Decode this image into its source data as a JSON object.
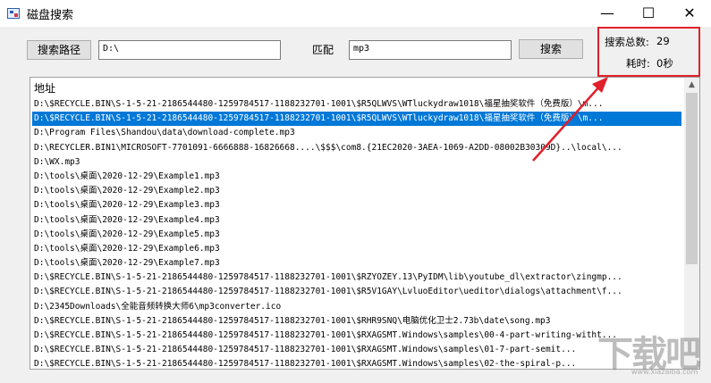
{
  "window": {
    "title": "磁盘搜索",
    "minimize": "—",
    "maximize": "☐",
    "close": "✕"
  },
  "search": {
    "path_button": "搜索路径",
    "path_value": "D:\\",
    "match_label": "匹配",
    "match_value": "mp3",
    "search_button": "搜索"
  },
  "stats": {
    "total_label": "搜索总数:",
    "total_value": "29",
    "time_label": "耗时:",
    "time_value": "0秒"
  },
  "list": {
    "header": "地址",
    "selected_index": 1,
    "rows": [
      "D:\\$RECYCLE.BIN\\S-1-5-21-2186544480-1259784517-1188232701-1001\\$R5QLWVS\\WTluckydraw1018\\福星抽奖软件（免费版）\\m...",
      "D:\\$RECYCLE.BIN\\S-1-5-21-2186544480-1259784517-1188232701-1001\\$R5QLWVS\\WTluckydraw1018\\福星抽奖软件（免费版）\\m...",
      "D:\\Program Files\\Shandou\\data\\download-complete.mp3",
      "D:\\RECYCLER.BIN1\\MICROSOFT-7701091-6666888-16826668....\\$$$\\com8.{21EC2020-3AEA-1069-A2DD-08002B30309D}..\\local\\...",
      "D:\\WX.mp3",
      "D:\\tools\\桌面\\2020-12-29\\Example1.mp3",
      "D:\\tools\\桌面\\2020-12-29\\Example2.mp3",
      "D:\\tools\\桌面\\2020-12-29\\Example3.mp3",
      "D:\\tools\\桌面\\2020-12-29\\Example4.mp3",
      "D:\\tools\\桌面\\2020-12-29\\Example5.mp3",
      "D:\\tools\\桌面\\2020-12-29\\Example6.mp3",
      "D:\\tools\\桌面\\2020-12-29\\Example7.mp3",
      "D:\\$RECYCLE.BIN\\S-1-5-21-2186544480-1259784517-1188232701-1001\\$RZYOZEY.13\\PyIDM\\lib\\youtube_dl\\extractor\\zingmp...",
      "D:\\$RECYCLE.BIN\\S-1-5-21-2186544480-1259784517-1188232701-1001\\$R5V1GAY\\LvluoEditor\\ueditor\\dialogs\\attachment\\f...",
      "D:\\2345Downloads\\全能音频转换大师6\\mp3converter.ico",
      "D:\\$RECYCLE.BIN\\S-1-5-21-2186544480-1259784517-1188232701-1001\\$RHR9SNQ\\电脑优化卫士2.73b\\date\\song.mp3",
      "D:\\$RECYCLE.BIN\\S-1-5-21-2186544480-1259784517-1188232701-1001\\$RXAGSMT.Windows\\samples\\00-4-part-writing-witht...",
      "D:\\$RECYCLE.BIN\\S-1-5-21-2186544480-1259784517-1188232701-1001\\$RXAGSMT.Windows\\samples\\01-7-part-semit...",
      "D:\\$RECYCLE.BIN\\S-1-5-21-2186544480-1259784517-1188232701-1001\\$RXAGSMT.Windows\\samples\\02-the-spiral-p..."
    ]
  },
  "watermark": {
    "logo": "下载吧",
    "url": "www.xiazaiba.com"
  },
  "colors": {
    "selection": "#0078d7",
    "annotation": "#e0202a"
  }
}
